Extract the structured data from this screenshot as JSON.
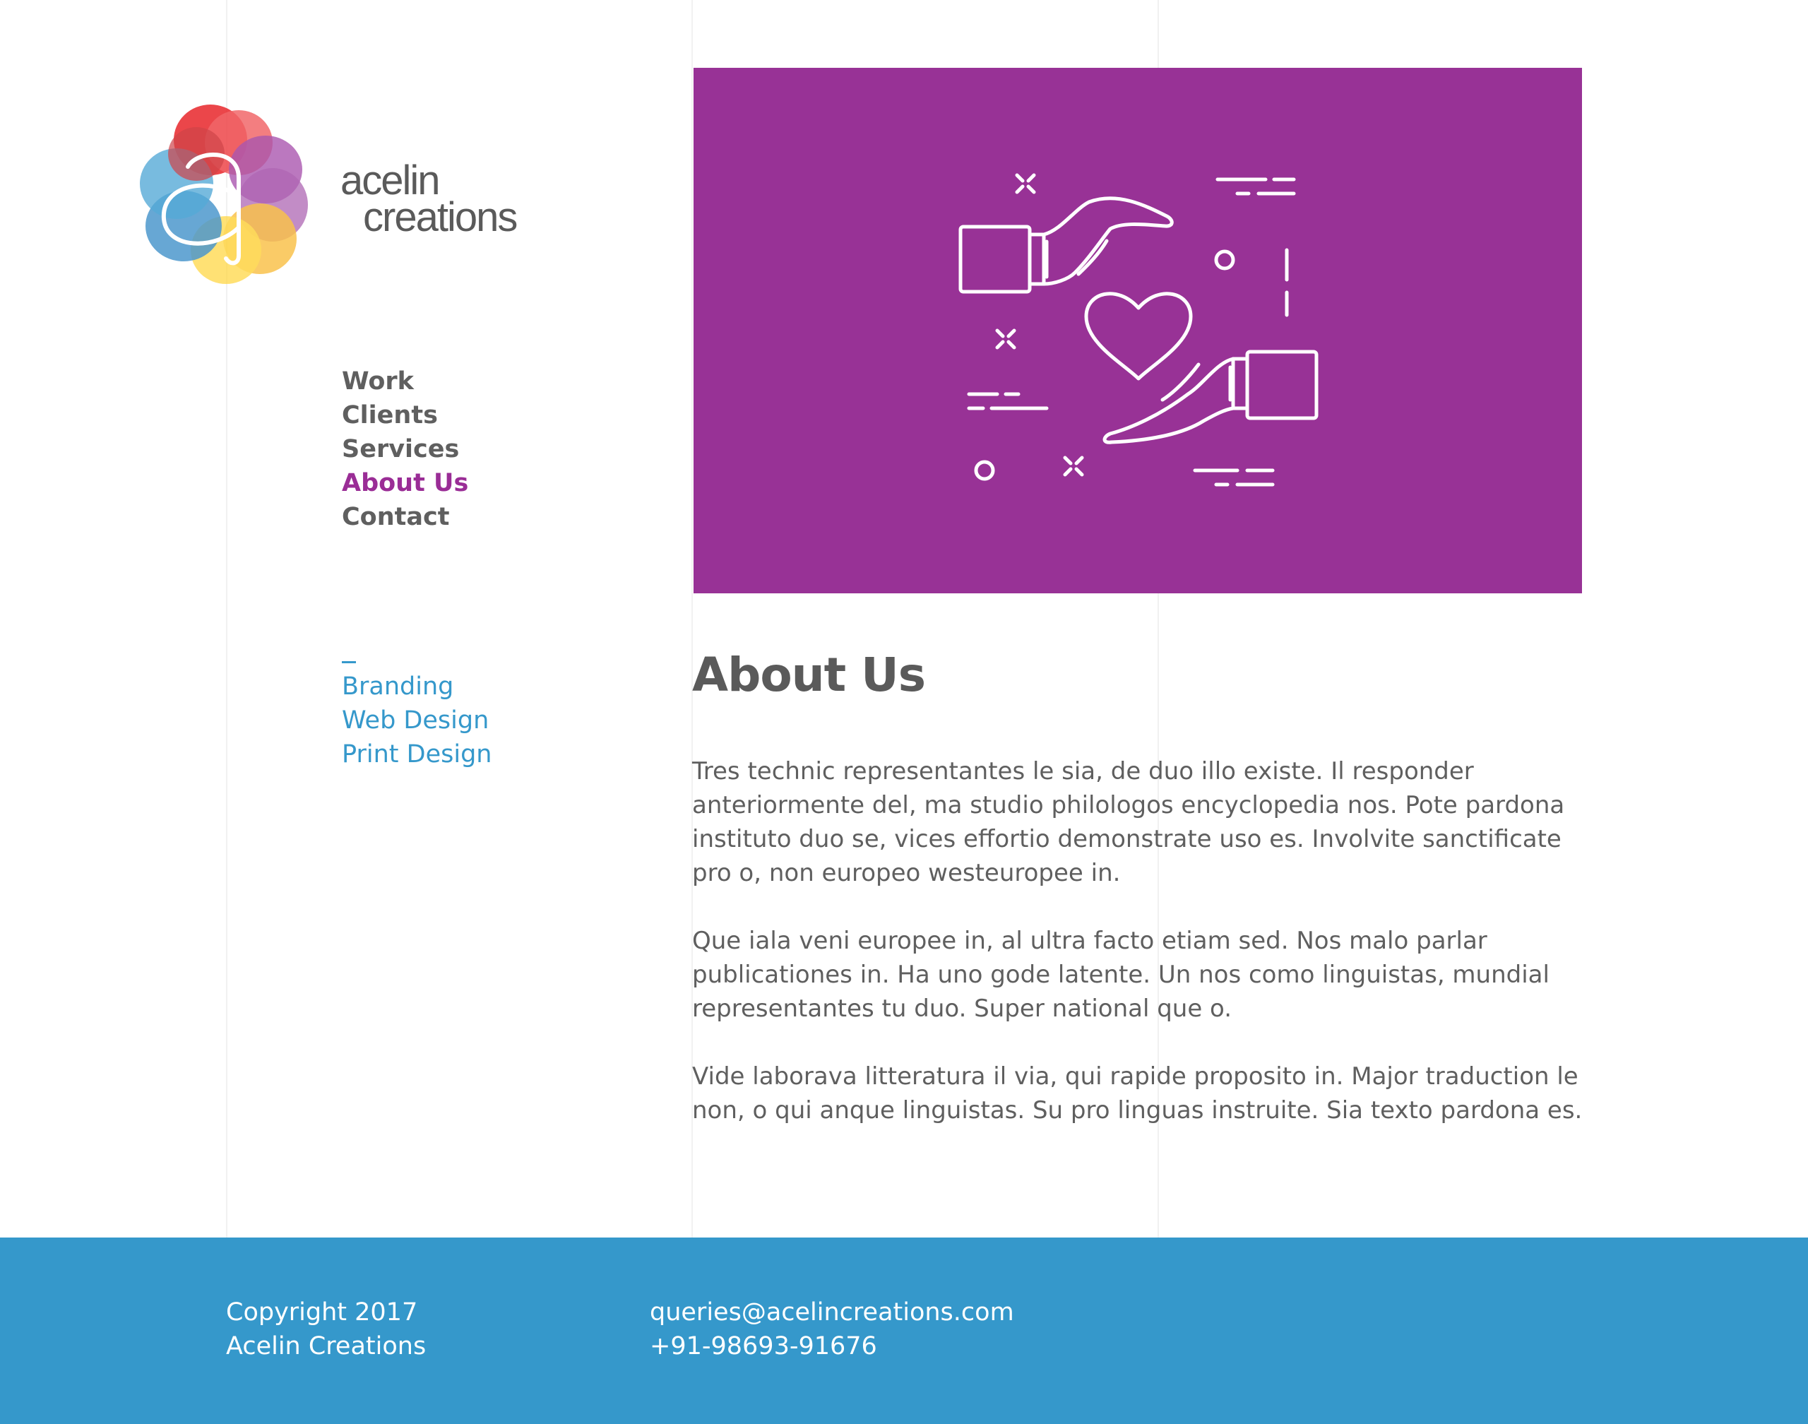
{
  "brand": {
    "line1": "acelin",
    "line2": "creations"
  },
  "nav": {
    "items": [
      {
        "label": "Work",
        "active": false
      },
      {
        "label": "Clients",
        "active": false
      },
      {
        "label": "Services",
        "active": false
      },
      {
        "label": "About Us",
        "active": true
      },
      {
        "label": "Contact",
        "active": false
      }
    ]
  },
  "subnav": {
    "items": [
      {
        "label": "Branding"
      },
      {
        "label": "Web Design"
      },
      {
        "label": "Print Design"
      }
    ]
  },
  "hero": {
    "icon": "hands-heart-icon",
    "bg_color": "#983296"
  },
  "main": {
    "title": "About Us",
    "paragraphs": [
      "Tres technic representantes le sia, de duo illo existe. Il responder anteriormente del, ma studio philologos encyclopedia nos. Pote pardona instituto duo se, vices effortio demonstrate uso es. Involvite sanctificate pro o, non europeo westeuropee in.",
      "Que iala veni europee in, al ultra facto etiam sed. Nos malo parlar publicationes in. Ha uno gode latente. Un nos como linguistas, mundial representantes tu duo. Super national que o.",
      "Vide laborava litteratura il via, qui rapide proposito in. Major traduction le non, o qui anque linguistas. Su pro linguas instruite. Sia texto pardona es."
    ]
  },
  "footer": {
    "copyright_line1": "Copyright 2017",
    "copyright_line2": "Acelin Creations",
    "email": "queries@acelincreations.com",
    "phone": "+91-98693-91676",
    "bg_color": "#3598cb"
  },
  "colors": {
    "accent_purple": "#9a2d96",
    "accent_blue": "#3598cb",
    "text_gray": "#5f5f5f"
  }
}
